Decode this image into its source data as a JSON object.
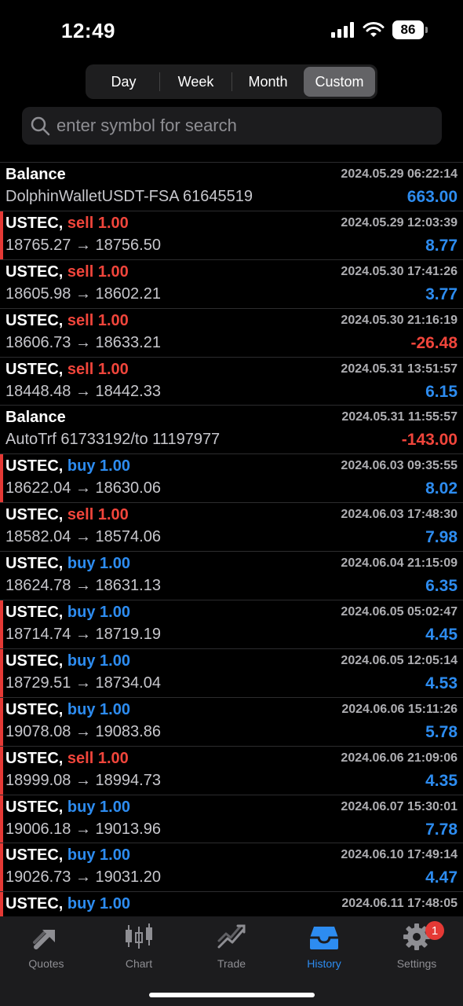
{
  "status": {
    "time": "12:49",
    "battery": "86"
  },
  "period_tabs": [
    {
      "label": "Day"
    },
    {
      "label": "Week"
    },
    {
      "label": "Month"
    },
    {
      "label": "Custom"
    }
  ],
  "active_period": "Custom",
  "search": {
    "placeholder": "enter symbol for search"
  },
  "rows": [
    {
      "type": "balance",
      "title": "Balance",
      "detail": "DolphinWalletUSDT-FSA 61645519",
      "time": "2024.05.29 06:22:14",
      "amount": "663.00",
      "sign": "pos",
      "marked": false
    },
    {
      "type": "trade",
      "symbol": "USTEC,",
      "direction": "sell 1.00",
      "dir_class": "sell",
      "prices": "18765.27 → 18756.50",
      "time": "2024.05.29 12:03:39",
      "amount": "8.77",
      "sign": "pos",
      "marked": true
    },
    {
      "type": "trade",
      "symbol": "USTEC,",
      "direction": "sell 1.00",
      "dir_class": "sell",
      "prices": "18605.98 → 18602.21",
      "time": "2024.05.30 17:41:26",
      "amount": "3.77",
      "sign": "pos",
      "marked": false
    },
    {
      "type": "trade",
      "symbol": "USTEC,",
      "direction": "sell 1.00",
      "dir_class": "sell",
      "prices": "18606.73 → 18633.21",
      "time": "2024.05.30 21:16:19",
      "amount": "-26.48",
      "sign": "neg",
      "marked": false
    },
    {
      "type": "trade",
      "symbol": "USTEC,",
      "direction": "sell 1.00",
      "dir_class": "sell",
      "prices": "18448.48 → 18442.33",
      "time": "2024.05.31 13:51:57",
      "amount": "6.15",
      "sign": "pos",
      "marked": false
    },
    {
      "type": "balance",
      "title": "Balance",
      "detail": "AutoTrf 61733192/to 11197977",
      "time": "2024.05.31 11:55:57",
      "amount": "-143.00",
      "sign": "neg",
      "marked": false
    },
    {
      "type": "trade",
      "symbol": "USTEC,",
      "direction": "buy 1.00",
      "dir_class": "buy",
      "prices": "18622.04 → 18630.06",
      "time": "2024.06.03 09:35:55",
      "amount": "8.02",
      "sign": "pos",
      "marked": true
    },
    {
      "type": "trade",
      "symbol": "USTEC,",
      "direction": "sell 1.00",
      "dir_class": "sell",
      "prices": "18582.04 → 18574.06",
      "time": "2024.06.03 17:48:30",
      "amount": "7.98",
      "sign": "pos",
      "marked": false
    },
    {
      "type": "trade",
      "symbol": "USTEC,",
      "direction": "buy 1.00",
      "dir_class": "buy",
      "prices": "18624.78 → 18631.13",
      "time": "2024.06.04 21:15:09",
      "amount": "6.35",
      "sign": "pos",
      "marked": false
    },
    {
      "type": "trade",
      "symbol": "USTEC,",
      "direction": "buy 1.00",
      "dir_class": "buy",
      "prices": "18714.74 → 18719.19",
      "time": "2024.06.05 05:02:47",
      "amount": "4.45",
      "sign": "pos",
      "marked": true
    },
    {
      "type": "trade",
      "symbol": "USTEC,",
      "direction": "buy 1.00",
      "dir_class": "buy",
      "prices": "18729.51 → 18734.04",
      "time": "2024.06.05 12:05:14",
      "amount": "4.53",
      "sign": "pos",
      "marked": true
    },
    {
      "type": "trade",
      "symbol": "USTEC,",
      "direction": "buy 1.00",
      "dir_class": "buy",
      "prices": "19078.08 → 19083.86",
      "time": "2024.06.06 15:11:26",
      "amount": "5.78",
      "sign": "pos",
      "marked": true
    },
    {
      "type": "trade",
      "symbol": "USTEC,",
      "direction": "sell 1.00",
      "dir_class": "sell",
      "prices": "18999.08 → 18994.73",
      "time": "2024.06.06 21:09:06",
      "amount": "4.35",
      "sign": "pos",
      "marked": true
    },
    {
      "type": "trade",
      "symbol": "USTEC,",
      "direction": "buy 1.00",
      "dir_class": "buy",
      "prices": "19006.18 → 19013.96",
      "time": "2024.06.07 15:30:01",
      "amount": "7.78",
      "sign": "pos",
      "marked": true
    },
    {
      "type": "trade",
      "symbol": "USTEC,",
      "direction": "buy 1.00",
      "dir_class": "buy",
      "prices": "19026.73 → 19031.20",
      "time": "2024.06.10 17:49:14",
      "amount": "4.47",
      "sign": "pos",
      "marked": true
    },
    {
      "type": "trade",
      "symbol": "USTEC,",
      "direction": "buy 1.00",
      "dir_class": "buy",
      "prices": "",
      "time": "2024.06.11 17:48:05",
      "amount": "",
      "sign": "pos",
      "marked": true
    }
  ],
  "tabbar": [
    {
      "label": "Quotes",
      "icon": "quotes-icon"
    },
    {
      "label": "Chart",
      "icon": "chart-icon"
    },
    {
      "label": "Trade",
      "icon": "trade-icon"
    },
    {
      "label": "History",
      "icon": "history-icon"
    },
    {
      "label": "Settings",
      "icon": "settings-icon",
      "badge": "1"
    }
  ],
  "active_tab": "History",
  "colors": {
    "accent": "#2d8cf0",
    "loss": "#f0453b",
    "marker": "#e53935"
  }
}
